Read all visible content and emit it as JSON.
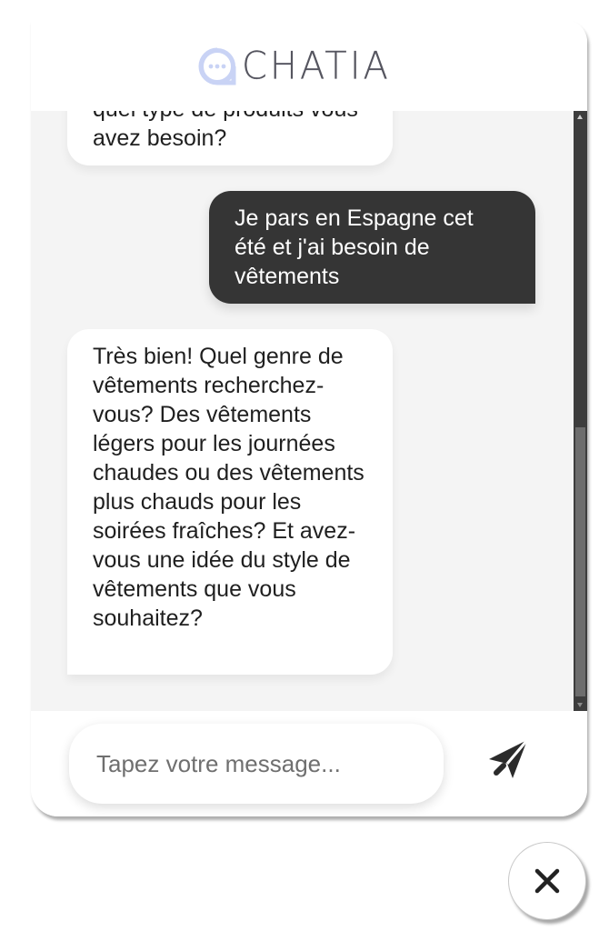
{
  "header": {
    "logo_text": "CHATIA",
    "brand_color": "#c9d3f5"
  },
  "messages": [
    {
      "sender": "bot",
      "text": "quel type de produits vous avez besoin?"
    },
    {
      "sender": "user",
      "text": "Je pars en Espagne cet été et j'ai besoin de vêtements"
    },
    {
      "sender": "bot",
      "text": "Très bien! Quel genre de vêtements recherchez-vous? Des vêtements légers pour les journées chaudes ou des vêtements plus chauds pour les soirées fraîches? Et avez-vous une idée du style de vêtements que vous souhaitez?"
    }
  ],
  "composer": {
    "placeholder": "Tapez votre message...",
    "value": "",
    "send_icon": "paper-plane-icon"
  },
  "close_icon": "close-icon",
  "colors": {
    "user_bubble": "#353535",
    "bot_bubble": "#ffffff",
    "chat_background": "#f4f4f4"
  }
}
